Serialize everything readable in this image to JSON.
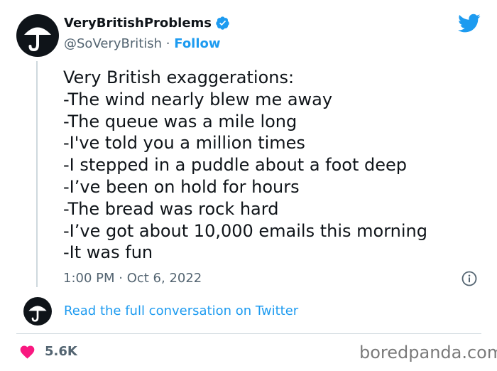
{
  "header": {
    "display_name": "VeryBritishProblems",
    "handle": "@SoVeryBritish",
    "separator": " · ",
    "follow_label": "Follow"
  },
  "tweet": {
    "lines": [
      "Very British exaggerations:",
      "-The wind nearly blew me away",
      "-The queue was a mile long",
      "-I've told you a million times",
      "-I stepped in a puddle about a foot deep",
      "-I’ve been on hold for hours",
      "-The bread was rock hard",
      "-I’ve got about 10,000 emails this morning",
      "-It was fun"
    ],
    "time": "1:00 PM",
    "date_separator": " · ",
    "date": "Oct 6, 2022"
  },
  "conversation_link": "Read the full conversation on Twitter",
  "likes": "5.6K",
  "watermark": "boredpanda.com",
  "icons": [
    "umbrella-icon",
    "verified-badge-icon",
    "twitter-bird-icon",
    "info-icon",
    "heart-icon"
  ],
  "colors": {
    "brand_blue": "#1d9bf0",
    "text_primary": "#0f1419",
    "text_secondary": "#536471",
    "heart": "#f91880",
    "divider": "#cfd9de"
  }
}
